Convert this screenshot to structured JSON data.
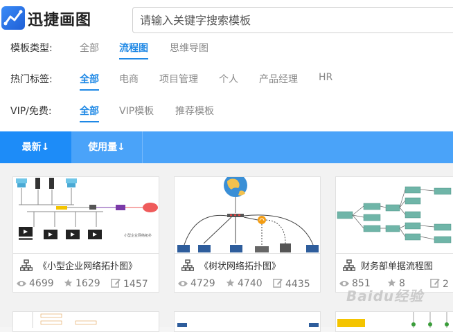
{
  "header": {
    "brand": "迅捷画图",
    "search_placeholder": "请输入关键字搜索模板"
  },
  "filters": [
    {
      "label": "模板类型:",
      "options": [
        {
          "text": "全部",
          "active": false
        },
        {
          "text": "流程图",
          "active": true
        },
        {
          "text": "思维导图",
          "active": false
        }
      ]
    },
    {
      "label": "热门标签:",
      "options": [
        {
          "text": "全部",
          "active": true
        },
        {
          "text": "电商",
          "active": false
        },
        {
          "text": "项目管理",
          "active": false
        },
        {
          "text": "个人",
          "active": false
        },
        {
          "text": "产品经理",
          "active": false
        },
        {
          "text": "HR",
          "active": false
        }
      ]
    },
    {
      "label": "VIP/免费:",
      "options": [
        {
          "text": "全部",
          "active": true
        },
        {
          "text": "VIP模板",
          "active": false
        },
        {
          "text": "推荐模板",
          "active": false
        }
      ]
    }
  ],
  "sort": {
    "newest": "最新↓",
    "usage": "使用量↓",
    "active": "newest"
  },
  "cards": [
    {
      "title": "《小型企业网络拓扑图》",
      "views": "4699",
      "favorites": "1629",
      "edits": "1457"
    },
    {
      "title": "《树状网络拓扑图》",
      "views": "4729",
      "favorites": "4740",
      "edits": "4435"
    },
    {
      "title": "财务部单据流程图",
      "views": "851",
      "favorites": "8",
      "edits": "2"
    }
  ],
  "watermark": "Baidu经验",
  "colors": {
    "accent": "#1e88e5",
    "sortbar": "#4aa3f9",
    "sort_active": "#1d8cf8"
  }
}
